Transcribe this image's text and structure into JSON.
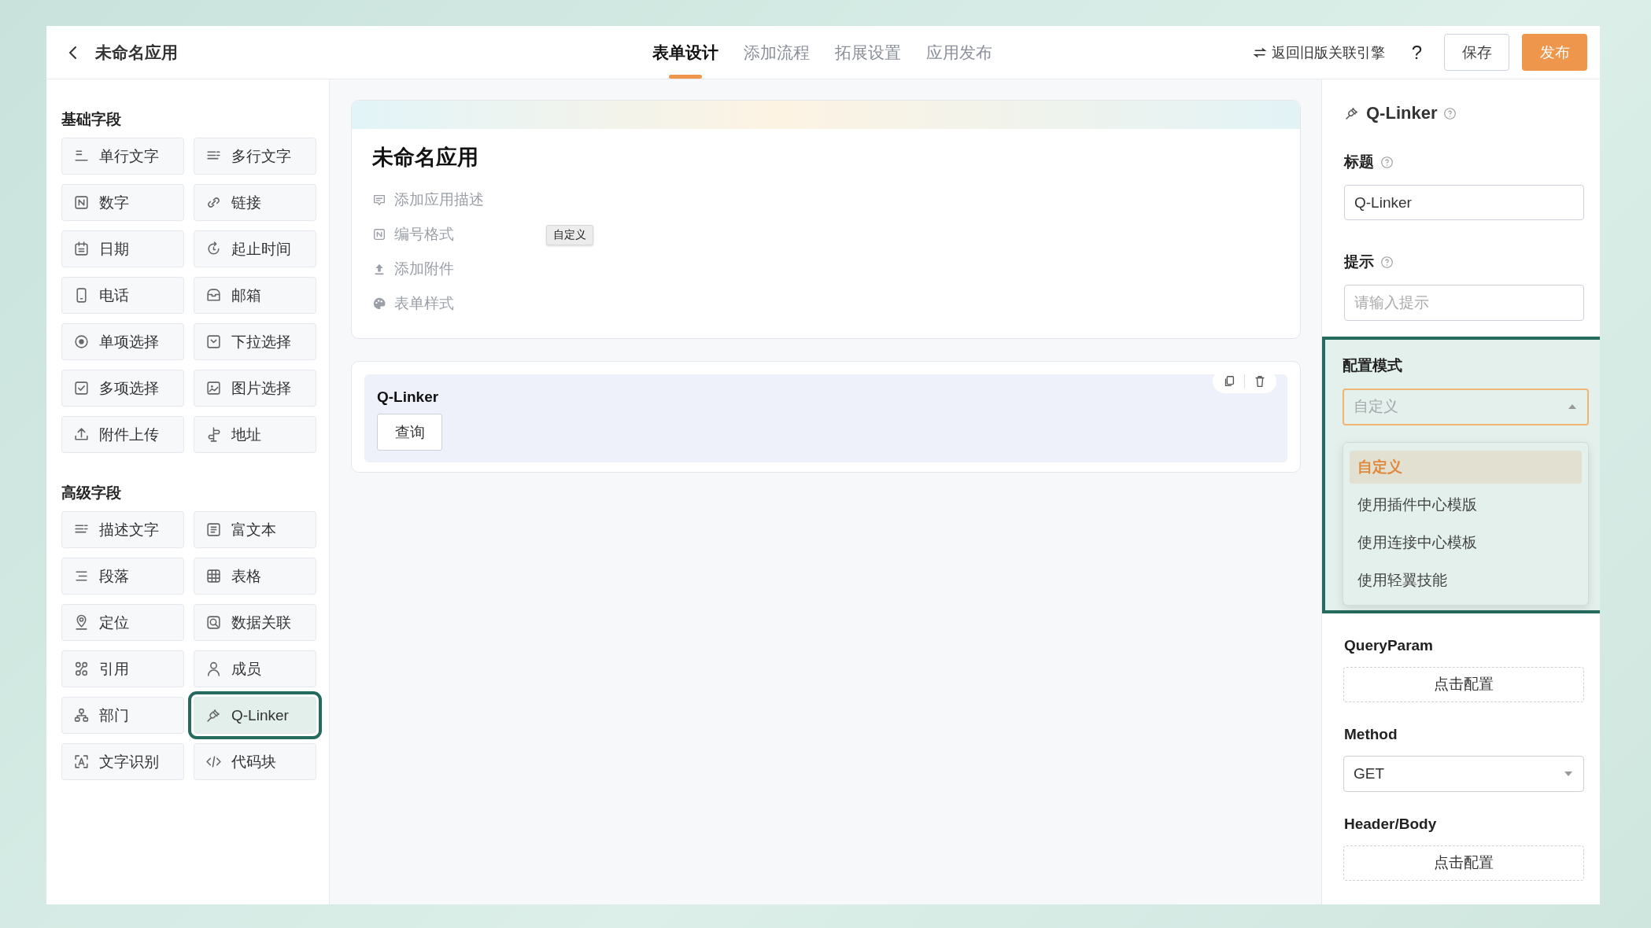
{
  "header": {
    "app_name": "未命名应用",
    "tabs": [
      {
        "label": "表单设计",
        "selected": true
      },
      {
        "label": "添加流程",
        "selected": false
      },
      {
        "label": "拓展设置",
        "selected": false
      },
      {
        "label": "应用发布",
        "selected": false
      }
    ],
    "legacy_link": "返回旧版关联引擎",
    "help": "?",
    "save": "保存",
    "publish": "发布"
  },
  "palette": {
    "groups": [
      {
        "title": "基础字段",
        "items": [
          {
            "label": "单行文字",
            "selected": false
          },
          {
            "label": "多行文字",
            "selected": false
          },
          {
            "label": "数字",
            "selected": false
          },
          {
            "label": "链接",
            "selected": false
          },
          {
            "label": "日期",
            "selected": false
          },
          {
            "label": "起止时间",
            "selected": false
          },
          {
            "label": "电话",
            "selected": false
          },
          {
            "label": "邮箱",
            "selected": false
          },
          {
            "label": "单项选择",
            "selected": false
          },
          {
            "label": "下拉选择",
            "selected": false
          },
          {
            "label": "多项选择",
            "selected": false
          },
          {
            "label": "图片选择",
            "selected": false
          },
          {
            "label": "附件上传",
            "selected": false
          },
          {
            "label": "地址",
            "selected": false
          }
        ]
      },
      {
        "title": "高级字段",
        "items": [
          {
            "label": "描述文字",
            "selected": false
          },
          {
            "label": "富文本",
            "selected": false
          },
          {
            "label": "段落",
            "selected": false
          },
          {
            "label": "表格",
            "selected": false
          },
          {
            "label": "定位",
            "selected": false
          },
          {
            "label": "数据关联",
            "selected": false
          },
          {
            "label": "引用",
            "selected": false
          },
          {
            "label": "成员",
            "selected": false
          },
          {
            "label": "部门",
            "selected": false
          },
          {
            "label": "Q-Linker",
            "selected": true
          },
          {
            "label": "文字识别",
            "selected": false
          },
          {
            "label": "代码块",
            "selected": false
          }
        ]
      }
    ]
  },
  "canvas": {
    "form_title": "未命名应用",
    "meta": [
      "添加应用描述",
      "编号格式",
      "添加附件",
      "表单样式"
    ],
    "tooltip": "自定义",
    "field": {
      "label": "Q-Linker",
      "button": "查询"
    }
  },
  "properties": {
    "title": "Q-Linker",
    "fields": [
      {
        "kind": "input",
        "label": "标题",
        "help": true,
        "value": "Q-Linker"
      },
      {
        "kind": "input",
        "label": "提示",
        "help": true,
        "placeholder": "请输入提示"
      }
    ],
    "config_mode": {
      "label": "配置模式",
      "highlighted": true,
      "value": "自定义",
      "expanded": true,
      "options": [
        {
          "label": "自定义",
          "selected": true
        },
        {
          "label": "使用插件中心模版",
          "selected": false
        },
        {
          "label": "使用连接中心模板",
          "selected": false
        },
        {
          "label": "使用轻翼技能",
          "selected": false
        }
      ]
    },
    "sections": [
      {
        "kind": "button",
        "label": "QueryParam",
        "text": "点击配置"
      },
      {
        "kind": "select",
        "label": "Method",
        "text": "GET"
      },
      {
        "kind": "button",
        "label": "Header/Body",
        "text": "点击配置"
      }
    ]
  }
}
